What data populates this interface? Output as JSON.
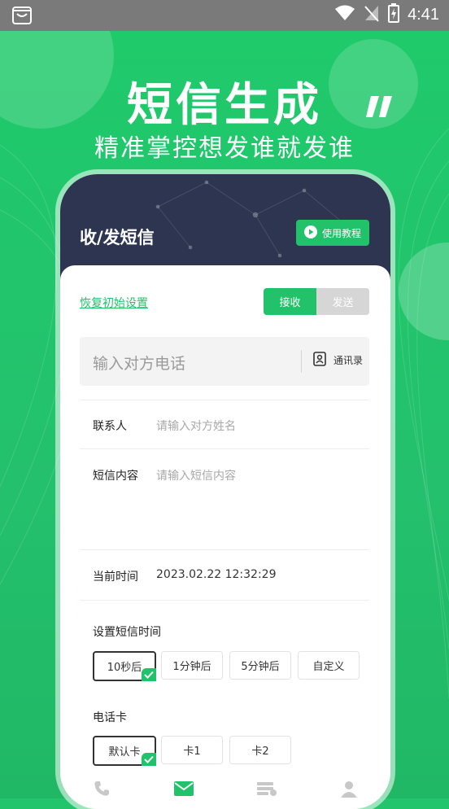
{
  "status_bar": {
    "time": "4:41"
  },
  "hero": {
    "title": "短信生成",
    "subtitle": "精准掌控想发谁就发谁"
  },
  "phone": {
    "header_title": "收/发短信",
    "tutorial_button": "使用教程",
    "reset_link": "恢复初始设置",
    "mode_tabs": [
      {
        "label": "接收",
        "active": true
      },
      {
        "label": "发送",
        "active": false
      }
    ],
    "phone_input_placeholder": "输入对方电话",
    "contacts_label": "通讯录",
    "fields": {
      "contact_label": "联系人",
      "contact_placeholder": "请输入对方姓名",
      "content_label": "短信内容",
      "content_placeholder": "请输入短信内容",
      "time_label": "当前时间",
      "time_value": "2023.02.22 12:32:29"
    },
    "sms_time": {
      "title": "设置短信时间",
      "options": [
        "10秒后",
        "1分钟后",
        "5分钟后",
        "自定义"
      ],
      "selected_index": 0
    },
    "sim_card": {
      "title": "电话卡",
      "options": [
        "默认卡",
        "卡1",
        "卡2"
      ],
      "selected_index": 0
    },
    "bottom_tabs": [
      {
        "icon": "phone-icon",
        "active": false
      },
      {
        "icon": "message-icon",
        "active": true
      },
      {
        "icon": "card-list-icon",
        "active": false
      },
      {
        "icon": "user-icon",
        "active": false
      }
    ]
  },
  "colors": {
    "brand_green": "#22c26b",
    "header_navy": "#2d3550"
  }
}
